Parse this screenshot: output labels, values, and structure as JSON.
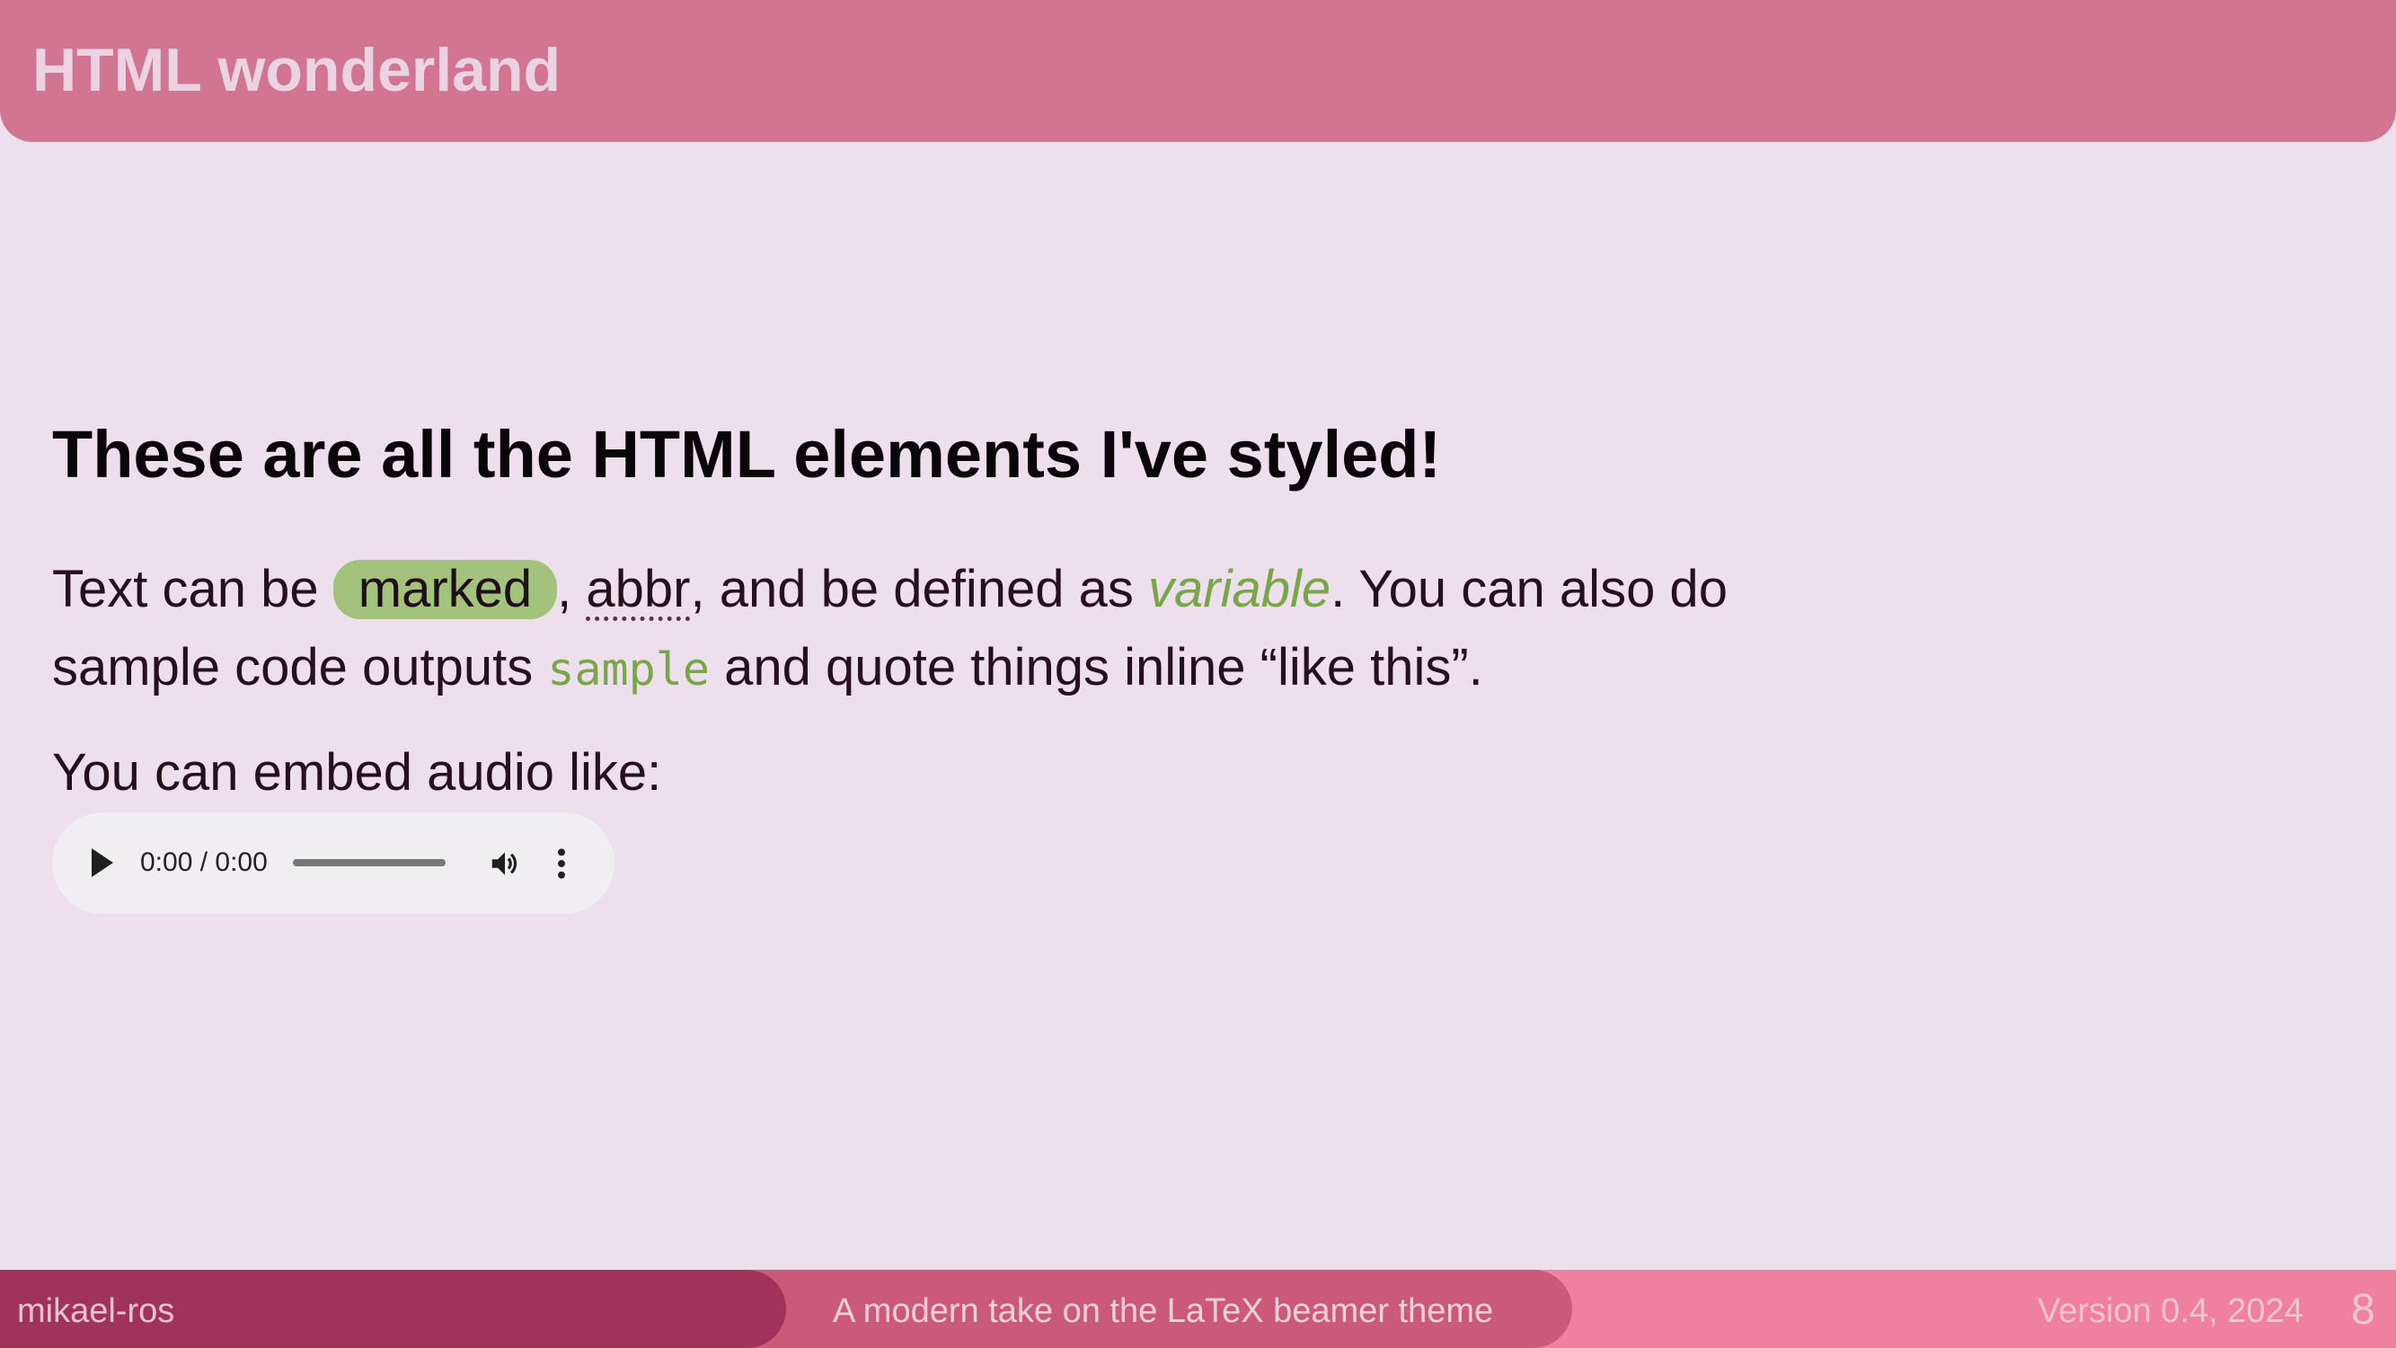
{
  "header": {
    "title": "HTML wonderland"
  },
  "content": {
    "heading": "These are all the HTML elements I've styled!",
    "para": {
      "t1": "Text can be ",
      "marked": "marked",
      "t2": ", ",
      "abbr": "abbr",
      "t3": ", and be defined as ",
      "variable": "variable",
      "t4": ". You can also do",
      "t5": "sample code outputs ",
      "sample": "sample",
      "t6": " and quote things inline “like this”."
    },
    "embed_text": "You can embed audio like:",
    "audio": {
      "time": "0:00 / 0:00",
      "progress": 0
    }
  },
  "footer": {
    "author": "mikael-ros",
    "subtitle": "A modern take on the LaTeX beamer theme",
    "version": "Version 0.4, 2024",
    "page": "8"
  },
  "colors": {
    "background": "#eedfec",
    "header": "#d27593",
    "accent_green": "#a3c27b",
    "footer_left": "#a0335a",
    "footer_mid": "#cb5a7a",
    "footer_right": "#ef809e"
  },
  "icons": [
    "play-icon",
    "volume-icon",
    "more-options-icon"
  ]
}
